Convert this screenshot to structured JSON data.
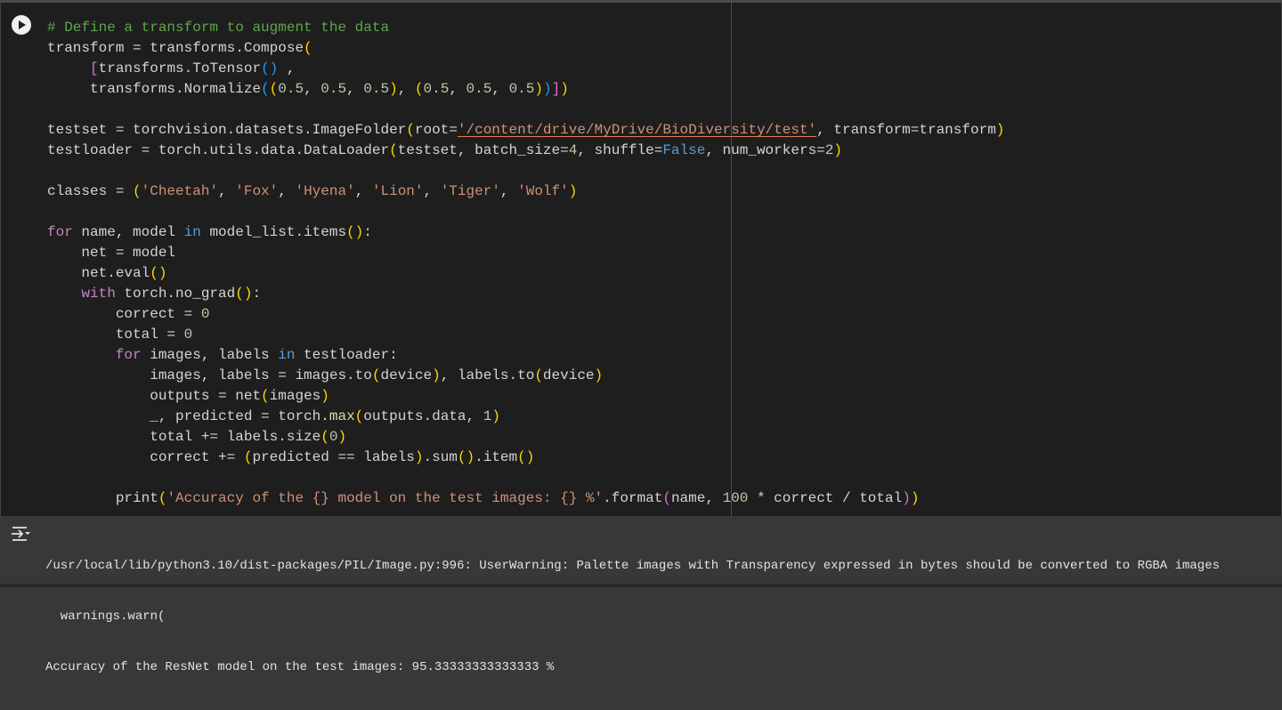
{
  "cell": {
    "run_button_icon": "play-circle-icon",
    "code_lines": [
      [
        [
          "c",
          "# Define a transform to augment the data"
        ]
      ],
      [
        [
          "",
          "transform = transforms.Compose"
        ],
        [
          "b1",
          "("
        ]
      ],
      [
        [
          "",
          "     "
        ],
        [
          "b2",
          "["
        ],
        [
          "",
          "transforms.ToTensor"
        ],
        [
          "b3",
          "()"
        ],
        [
          "",
          " ,"
        ]
      ],
      [
        [
          "",
          "     transforms.Normalize"
        ],
        [
          "b3",
          "("
        ],
        [
          "b1",
          "("
        ],
        [
          "n",
          "0.5"
        ],
        [
          "",
          ", "
        ],
        [
          "n",
          "0.5"
        ],
        [
          "",
          ", "
        ],
        [
          "n",
          "0.5"
        ],
        [
          "b1",
          ")"
        ],
        [
          "",
          ", "
        ],
        [
          "b1",
          "("
        ],
        [
          "n",
          "0.5"
        ],
        [
          "",
          ", "
        ],
        [
          "n",
          "0.5"
        ],
        [
          "",
          ", "
        ],
        [
          "n",
          "0.5"
        ],
        [
          "b1",
          ")"
        ],
        [
          "b3",
          ")"
        ],
        [
          "b2",
          "]"
        ],
        [
          "b1",
          ")"
        ]
      ],
      [],
      [
        [
          "",
          "testset = torchvision.datasets.ImageFolder"
        ],
        [
          "b1",
          "("
        ],
        [
          "",
          "root="
        ],
        [
          "s u",
          "'/content/drive/MyDrive/BioDiversity/test'"
        ],
        [
          "",
          ", transform=transform"
        ],
        [
          "b1",
          ")"
        ]
      ],
      [
        [
          "",
          "testloader = torch.utils.data.DataLoader"
        ],
        [
          "b1",
          "("
        ],
        [
          "",
          "testset, batch_size="
        ],
        [
          "n",
          "4"
        ],
        [
          "",
          ", shuffle="
        ],
        [
          "kb",
          "False"
        ],
        [
          "",
          ", num_workers="
        ],
        [
          "n",
          "2"
        ],
        [
          "b1",
          ")"
        ]
      ],
      [],
      [
        [
          "",
          "classes = "
        ],
        [
          "b1",
          "("
        ],
        [
          "s",
          "'Cheetah'"
        ],
        [
          "",
          ", "
        ],
        [
          "s",
          "'Fox'"
        ],
        [
          "",
          ", "
        ],
        [
          "s",
          "'Hyena'"
        ],
        [
          "",
          ", "
        ],
        [
          "s",
          "'Lion'"
        ],
        [
          "",
          ", "
        ],
        [
          "s",
          "'Tiger'"
        ],
        [
          "",
          ", "
        ],
        [
          "s",
          "'Wolf'"
        ],
        [
          "b1",
          ")"
        ]
      ],
      [],
      [
        [
          "k",
          "for"
        ],
        [
          "",
          " name, model "
        ],
        [
          "kb",
          "in"
        ],
        [
          "",
          " model_list.items"
        ],
        [
          "b1",
          "()"
        ],
        [
          "",
          ":"
        ]
      ],
      [
        [
          "",
          "    net = model"
        ]
      ],
      [
        [
          "",
          "    net.eval"
        ],
        [
          "b1",
          "()"
        ]
      ],
      [
        [
          "",
          "    "
        ],
        [
          "k",
          "with"
        ],
        [
          "",
          " torch.no_grad"
        ],
        [
          "b1",
          "()"
        ],
        [
          "",
          ":"
        ]
      ],
      [
        [
          "",
          "        correct = "
        ],
        [
          "n",
          "0"
        ]
      ],
      [
        [
          "",
          "        total = "
        ],
        [
          "n",
          "0"
        ]
      ],
      [
        [
          "",
          "        "
        ],
        [
          "k",
          "for"
        ],
        [
          "",
          " images, labels "
        ],
        [
          "kb",
          "in"
        ],
        [
          "",
          " testloader:"
        ]
      ],
      [
        [
          "",
          "            images, labels = images.to"
        ],
        [
          "b1",
          "("
        ],
        [
          "",
          "device"
        ],
        [
          "b1",
          ")"
        ],
        [
          "",
          ", labels.to"
        ],
        [
          "b1",
          "("
        ],
        [
          "",
          "device"
        ],
        [
          "b1",
          ")"
        ]
      ],
      [
        [
          "",
          "            outputs = net"
        ],
        [
          "b1",
          "("
        ],
        [
          "",
          "images"
        ],
        [
          "b1",
          ")"
        ]
      ],
      [
        [
          "",
          "            _, predicted = torch."
        ],
        [
          "f",
          "max"
        ],
        [
          "b1",
          "("
        ],
        [
          "",
          "outputs.data, "
        ],
        [
          "n",
          "1"
        ],
        [
          "b1",
          ")"
        ]
      ],
      [
        [
          "",
          "            total += labels.size"
        ],
        [
          "b1",
          "("
        ],
        [
          "n",
          "0"
        ],
        [
          "b1",
          ")"
        ]
      ],
      [
        [
          "",
          "            correct += "
        ],
        [
          "b1",
          "("
        ],
        [
          "",
          "predicted == labels"
        ],
        [
          "b1",
          ")"
        ],
        [
          "",
          ".sum"
        ],
        [
          "b1",
          "()"
        ],
        [
          "",
          ".item"
        ],
        [
          "b1",
          "()"
        ]
      ],
      [],
      [
        [
          "",
          "        print"
        ],
        [
          "b1",
          "("
        ],
        [
          "s",
          "'Accuracy of the {} model on the test images: {} %'"
        ],
        [
          "",
          ".format"
        ],
        [
          "b2",
          "("
        ],
        [
          "",
          "name, "
        ],
        [
          "n",
          "100"
        ],
        [
          "",
          " * correct / total"
        ],
        [
          "b2",
          ")"
        ],
        [
          "b1",
          ")"
        ]
      ]
    ]
  },
  "output": {
    "icon": "output-toggle-icon",
    "lines": [
      "/usr/local/lib/python3.10/dist-packages/PIL/Image.py:996: UserWarning: Palette images with Transparency expressed in bytes should be converted to RGBA images",
      "  warnings.warn(",
      "Accuracy of the ResNet model on the test images: 95.33333333333333 %"
    ]
  }
}
